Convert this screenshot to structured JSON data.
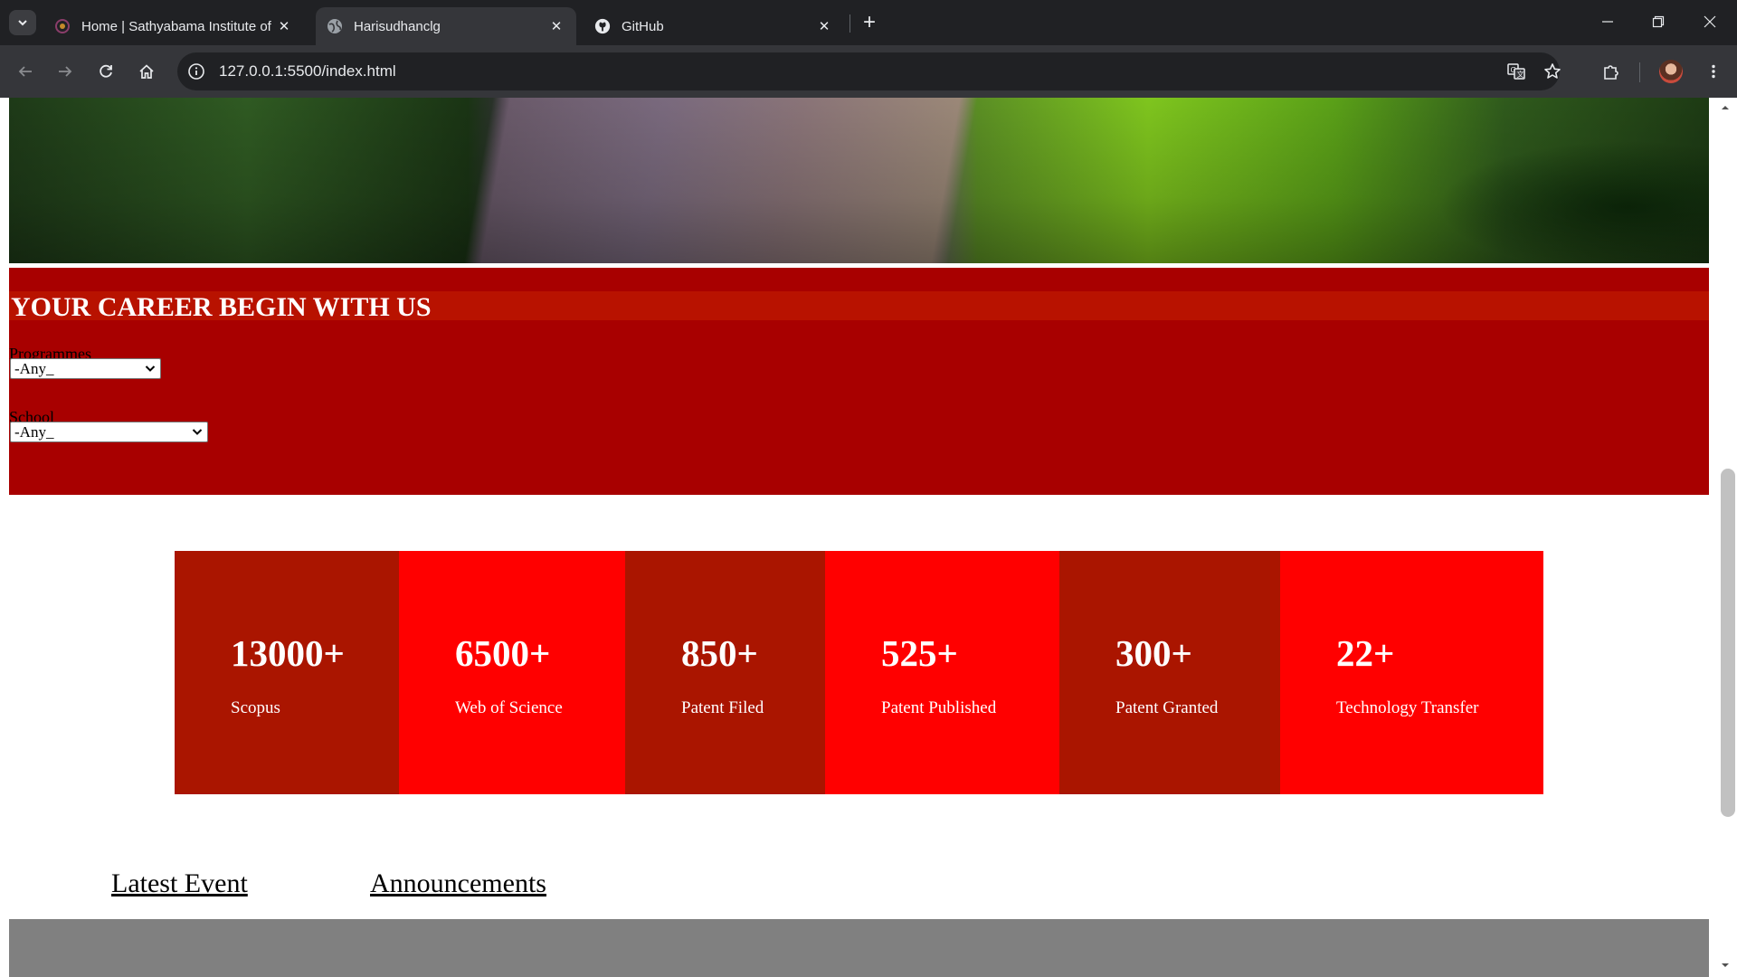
{
  "browser": {
    "tabs": [
      {
        "title": "Home | Sathyabama Institute of",
        "favicon": "sathyabama-favicon",
        "active": false
      },
      {
        "title": "Harisudhanclg",
        "favicon": "globe-icon",
        "active": true
      },
      {
        "title": "GitHub",
        "favicon": "github-icon",
        "active": false
      }
    ],
    "url": "127.0.0.1:5500/index.html",
    "colors": {
      "frame": "#202124",
      "toolbar": "#35363a",
      "text": "#e8eaed"
    }
  },
  "page": {
    "career": {
      "title": "YOUR CAREER BEGIN WITH US",
      "programmes_label": "Programmes",
      "programmes_value": "-Any_",
      "school_label": "School",
      "school_value": "-Any_",
      "bg_color": "#a80000"
    },
    "stats": [
      {
        "number": "13000+",
        "label": "Scopus",
        "color": "#aa1500"
      },
      {
        "number": "6500+",
        "label": "Web of Science",
        "color": "#ff0000"
      },
      {
        "number": "850+",
        "label": "Patent Filed",
        "color": "#aa1500"
      },
      {
        "number": "525+",
        "label": "Patent Published",
        "color": "#ff0000"
      },
      {
        "number": "300+",
        "label": "Patent Granted",
        "color": "#aa1500"
      },
      {
        "number": "22+",
        "label": "Technology Transfer",
        "color": "#ff0000"
      }
    ],
    "links": {
      "latest_event": "Latest Event",
      "announcements": "Announcements"
    }
  }
}
